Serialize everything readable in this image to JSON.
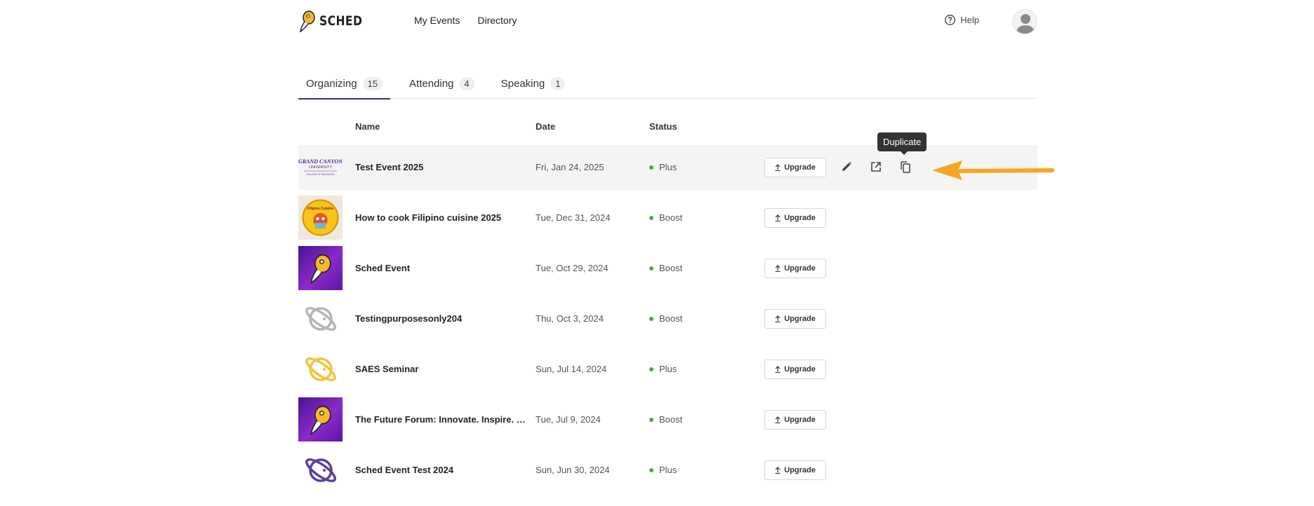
{
  "header": {
    "logo_text": "SCHED",
    "nav": [
      "My Events",
      "Directory"
    ],
    "help_label": "Help"
  },
  "tabs": [
    {
      "label": "Organizing",
      "count": "15"
    },
    {
      "label": "Attending",
      "count": "4"
    },
    {
      "label": "Speaking",
      "count": "1"
    }
  ],
  "table": {
    "columns": {
      "name": "Name",
      "date": "Date",
      "status": "Status"
    },
    "upgrade_label": "Upgrade",
    "rows": [
      {
        "name": "Test Event 2025",
        "date": "Fri, Jan 24, 2025",
        "status": "Plus",
        "thumb": "gcu-logo"
      },
      {
        "name": "How to cook Filipino cuisine 2025",
        "date": "Tue, Dec 31, 2024",
        "status": "Boost",
        "thumb": "filipino-cuisine-badge"
      },
      {
        "name": "Sched Event",
        "date": "Tue, Oct 29, 2024",
        "status": "Boost",
        "thumb": "sched-purple"
      },
      {
        "name": "Testingpurposesonly204",
        "date": "Thu, Oct 3, 2024",
        "status": "Boost",
        "thumb": "planet-gray"
      },
      {
        "name": "SAES Seminar",
        "date": "Sun, Jul 14, 2024",
        "status": "Plus",
        "thumb": "planet-yellow"
      },
      {
        "name": "The Future Forum: Innovate. Inspire. Impact.",
        "date": "Tue, Jul 9, 2024",
        "status": "Boost",
        "thumb": "sched-purple"
      },
      {
        "name": "Sched Event Test 2024",
        "date": "Sun, Jun 30, 2024",
        "status": "Plus",
        "thumb": "planet-purple"
      }
    ]
  },
  "tooltip": "Duplicate",
  "thumb_text": {
    "gcu_line1": "GRAND CANYON",
    "gcu_line2": "UNIVERSITY",
    "gcu_line3": "COLLEGE OF EDUCATION",
    "filipino": "Filipino Cuisine"
  },
  "colors": {
    "accent": "#3a2a8a",
    "status_dot": "#3cb043",
    "arrow": "#f5a623",
    "tooltip_bg": "#333333"
  }
}
